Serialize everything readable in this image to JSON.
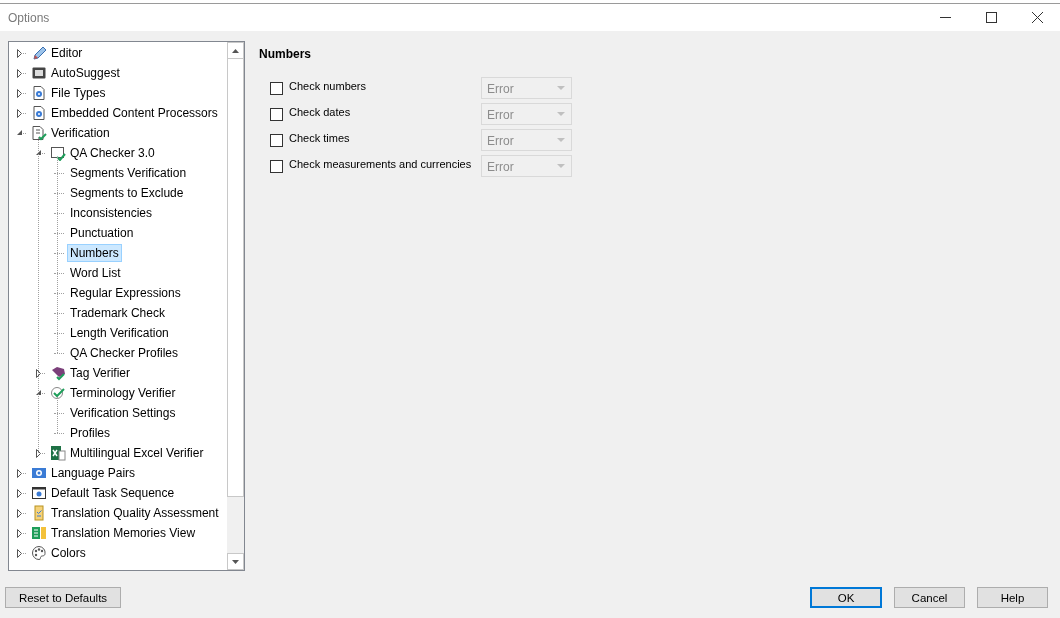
{
  "window": {
    "title": "Options"
  },
  "tree": [
    {
      "label": "Editor",
      "expanded": false,
      "selected": false
    },
    {
      "label": "AutoSuggest",
      "expanded": false,
      "selected": false
    },
    {
      "label": "File Types",
      "expanded": false,
      "selected": false
    },
    {
      "label": "Embedded Content Processors",
      "expanded": false,
      "selected": false
    },
    {
      "label": "Verification",
      "expanded": true,
      "selected": false,
      "children": [
        {
          "label": "QA Checker 3.0",
          "expanded": true,
          "selected": false,
          "children": [
            {
              "label": "Segments Verification",
              "selected": false
            },
            {
              "label": "Segments to Exclude",
              "selected": false
            },
            {
              "label": "Inconsistencies",
              "selected": false
            },
            {
              "label": "Punctuation",
              "selected": false
            },
            {
              "label": "Numbers",
              "selected": true
            },
            {
              "label": "Word List",
              "selected": false
            },
            {
              "label": "Regular Expressions",
              "selected": false
            },
            {
              "label": "Trademark Check",
              "selected": false
            },
            {
              "label": "Length Verification",
              "selected": false
            },
            {
              "label": "QA Checker Profiles",
              "selected": false
            }
          ]
        },
        {
          "label": "Tag Verifier",
          "expanded": false,
          "selected": false
        },
        {
          "label": "Terminology Verifier",
          "expanded": true,
          "selected": false,
          "children": [
            {
              "label": "Verification Settings",
              "selected": false
            },
            {
              "label": "Profiles",
              "selected": false
            }
          ]
        },
        {
          "label": "Multilingual Excel Verifier",
          "expanded": false,
          "selected": false
        }
      ]
    },
    {
      "label": "Language Pairs",
      "expanded": false,
      "selected": false
    },
    {
      "label": "Default Task Sequence",
      "expanded": false,
      "selected": false
    },
    {
      "label": "Translation Quality Assessment",
      "expanded": false,
      "selected": false
    },
    {
      "label": "Translation Memories View",
      "expanded": false,
      "selected": false
    },
    {
      "label": "Colors",
      "expanded": false,
      "selected": false
    }
  ],
  "panel": {
    "heading": "Numbers",
    "options": [
      {
        "label": "Check numbers",
        "checked": false,
        "severity": "Error",
        "disabled": true
      },
      {
        "label": "Check dates",
        "checked": false,
        "severity": "Error",
        "disabled": true
      },
      {
        "label": "Check times",
        "checked": false,
        "severity": "Error",
        "disabled": true
      },
      {
        "label": "Check measurements and currencies",
        "checked": false,
        "severity": "Error",
        "disabled": true
      }
    ]
  },
  "buttons": {
    "left": [
      {
        "label": "Reset to Defaults",
        "default": false
      }
    ],
    "right": [
      {
        "label": "OK",
        "default": true
      },
      {
        "label": "Cancel",
        "default": false
      },
      {
        "label": "Help",
        "default": false
      }
    ]
  }
}
